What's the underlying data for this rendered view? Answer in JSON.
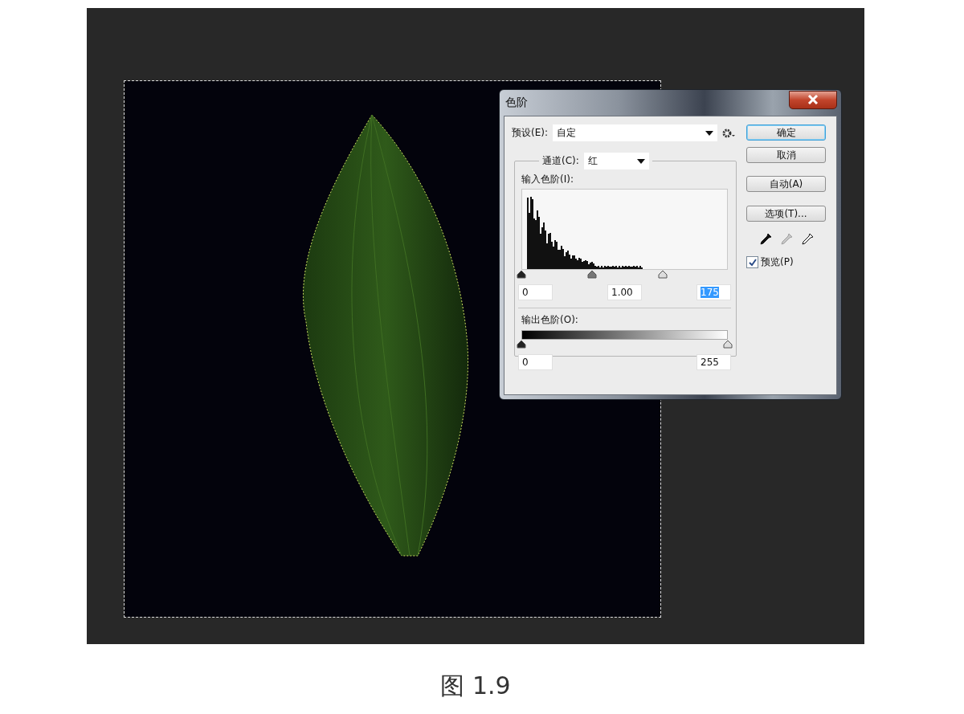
{
  "dialog": {
    "title": "色阶",
    "preset": {
      "label": "预设(E):",
      "value": "自定"
    },
    "channel": {
      "label": "通道(C):",
      "value": "红"
    },
    "input_levels": {
      "label": "输入色阶(I):",
      "sliders": [
        {
          "kind": "black",
          "level": 0
        },
        {
          "kind": "gray",
          "level": 0.343
        },
        {
          "kind": "white",
          "level": 0.686
        }
      ],
      "fields": [
        {
          "value": "0",
          "highlighted": false
        },
        {
          "value": "1.00",
          "highlighted": false
        },
        {
          "value": "175",
          "highlighted": true
        }
      ]
    },
    "output_levels": {
      "label": "输出色阶(O):",
      "sliders": [
        {
          "kind": "black",
          "level": 0
        },
        {
          "kind": "white",
          "level": 1
        }
      ],
      "fields": [
        {
          "value": "0",
          "highlighted": false
        },
        {
          "value": "255",
          "highlighted": false
        }
      ]
    },
    "buttons": [
      {
        "label": "确定",
        "default": true
      },
      {
        "label": "取消",
        "default": false
      },
      {
        "label": "自动(A)",
        "default": false
      },
      {
        "label": "选项(T)...",
        "default": false
      }
    ],
    "eyedroppers": [
      {
        "kind": "black",
        "disabled": false
      },
      {
        "kind": "gray",
        "disabled": true
      },
      {
        "kind": "white",
        "disabled": false
      }
    ],
    "preview": {
      "label": "预览(P)",
      "checked": true
    }
  },
  "caption": "图 1.9"
}
